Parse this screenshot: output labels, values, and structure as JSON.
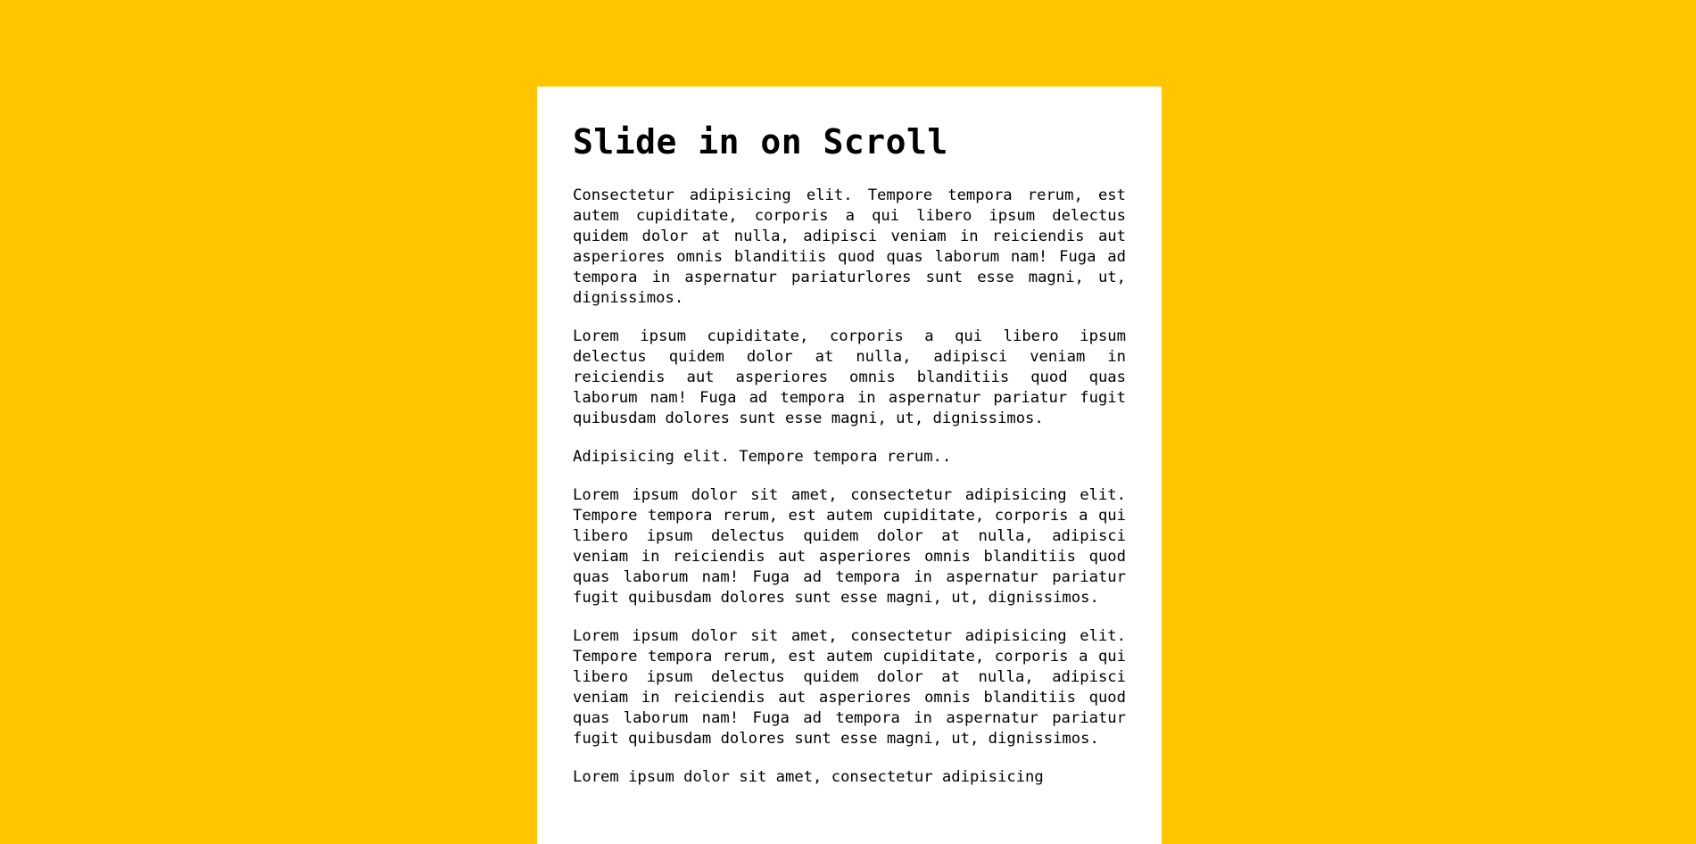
{
  "page": {
    "title": "Slide in on Scroll",
    "paragraphs": [
      "Consectetur adipisicing elit. Tempore tempora rerum, est autem cupiditate, corporis a qui libero ipsum delectus quidem dolor at nulla, adipisci veniam in reiciendis aut asperiores omnis blanditiis quod quas laborum nam! Fuga ad tempora in aspernatur pariaturlores sunt esse magni, ut, dignissimos.",
      "Lorem ipsum cupiditate, corporis a qui libero ipsum delectus quidem dolor at nulla, adipisci veniam in reiciendis aut asperiores omnis blanditiis quod quas laborum nam! Fuga ad tempora in aspernatur pariatur fugit quibusdam dolores sunt esse magni, ut, dignissimos.",
      "Adipisicing elit. Tempore tempora rerum..",
      "Lorem ipsum dolor sit amet, consectetur adipisicing elit. Tempore tempora rerum, est autem cupiditate, corporis a qui libero ipsum delectus quidem dolor at nulla, adipisci veniam in reiciendis aut asperiores omnis blanditiis quod quas laborum nam! Fuga ad tempora in aspernatur pariatur fugit quibusdam dolores sunt esse magni, ut, dignissimos.",
      "Lorem ipsum dolor sit amet, consectetur adipisicing elit. Tempore tempora rerum, est autem cupiditate, corporis a qui libero ipsum delectus quidem dolor at nulla, adipisci veniam in reiciendis aut asperiores omnis blanditiis quod quas laborum nam! Fuga ad tempora in aspernatur pariatur fugit quibusdam dolores sunt esse magni, ut, dignissimos.",
      "Lorem ipsum dolor sit amet, consectetur adipisicing"
    ]
  },
  "colors": {
    "background": "#ffc600",
    "panel": "#ffffff",
    "text": "#000000"
  }
}
